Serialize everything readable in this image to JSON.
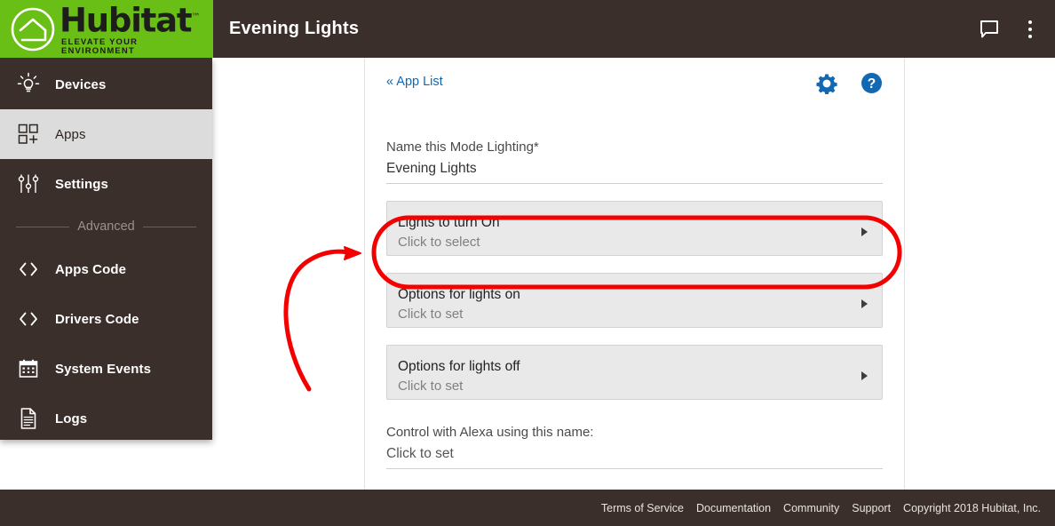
{
  "brand": {
    "name": "Hubitat",
    "trademark": "™",
    "tagline": "ELEVATE YOUR ENVIRONMENT",
    "logo_icon": "house-in-circle-icon",
    "green": "#6abf16",
    "dark": "#3a2f2a"
  },
  "topbar": {
    "title": "Evening Lights",
    "chat_icon": "chat-bubble-icon",
    "menu_icon": "kebab-menu-icon"
  },
  "sidebar": {
    "items": [
      {
        "label": "Devices",
        "icon": "lightbulb-icon",
        "selected": false
      },
      {
        "label": "Apps",
        "icon": "apps-grid-plus-icon",
        "selected": true
      },
      {
        "label": "Settings",
        "icon": "sliders-icon",
        "selected": false
      }
    ],
    "divider_label": "Advanced",
    "advanced_items": [
      {
        "label": "Apps Code",
        "icon": "code-brackets-icon",
        "selected": false
      },
      {
        "label": "Drivers Code",
        "icon": "code-brackets-icon",
        "selected": false
      },
      {
        "label": "System Events",
        "icon": "calendar-icon",
        "selected": false
      },
      {
        "label": "Logs",
        "icon": "document-lines-icon",
        "selected": false
      }
    ]
  },
  "panel": {
    "back_link": "« App List",
    "gear_icon": "gear-icon",
    "help_icon": "question-help-icon",
    "accent_blue": "#1268b3",
    "name_field": {
      "label": "Name this Mode Lighting*",
      "value": "Evening Lights"
    },
    "sections": [
      {
        "title": "Lights to turn On",
        "subtitle": "Click to select",
        "caret": "caret-right-icon",
        "highlighted": true
      },
      {
        "title": "Options for lights on",
        "subtitle": "Click to set",
        "caret": "caret-right-icon",
        "highlighted": false
      },
      {
        "title": "Options for lights off",
        "subtitle": "Click to set",
        "caret": "caret-right-icon",
        "highlighted": false
      }
    ],
    "alexa_field": {
      "label": "Control with Alexa using this name:",
      "value": "Click to set"
    }
  },
  "footer": {
    "links": [
      "Terms of Service",
      "Documentation",
      "Community",
      "Support"
    ],
    "copyright": "Copyright 2018 Hubitat, Inc."
  },
  "annotations": {
    "color": "#f40000",
    "oval": "highlight-oval-around-lights-to-turn-on",
    "arrow": "curved-arrow-pointing-to-lights-to-turn-on"
  }
}
